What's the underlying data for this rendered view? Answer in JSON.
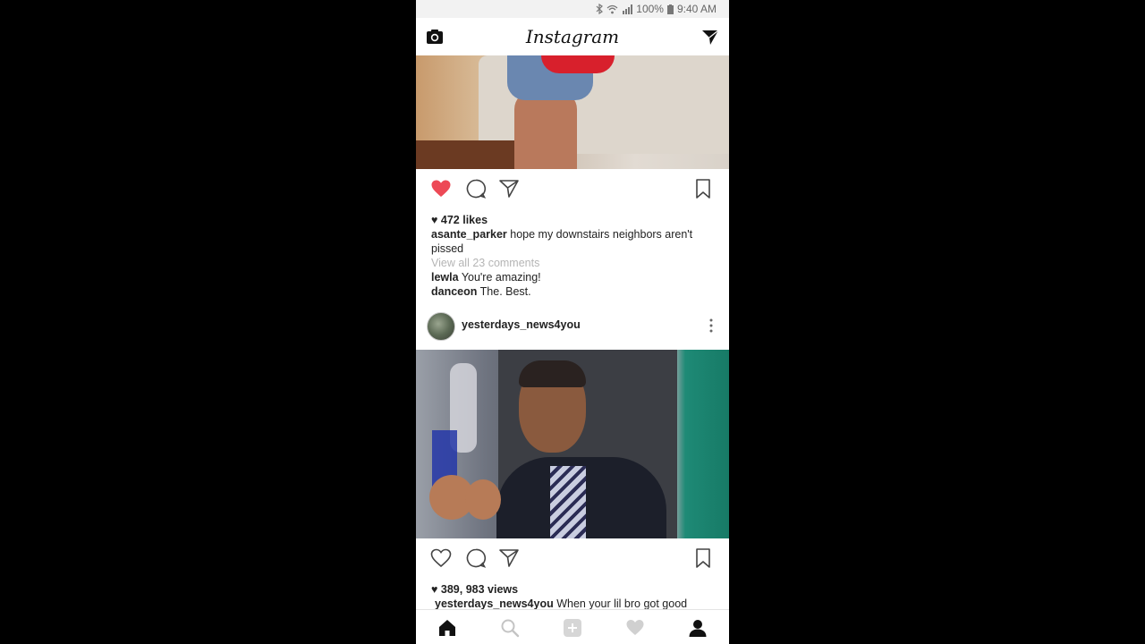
{
  "status_bar": {
    "battery": "100%",
    "time": "9:40 AM"
  },
  "header": {
    "title": "Instagram",
    "camera_icon": "camera-icon",
    "direct_icon": "direct-message-icon"
  },
  "post1": {
    "liked": true,
    "likes": "472 likes",
    "caption_user": "asante_parker",
    "caption_text": "hope my downstairs neighbors aren't pissed",
    "view_comments": "View all 23 comments",
    "comments": [
      {
        "user": "lewla",
        "text": "You're amazing!"
      },
      {
        "user": "danceon",
        "text": "The. Best."
      }
    ]
  },
  "post2": {
    "username": "yesterdays_news4you",
    "liked": false,
    "views": "389, 983 views",
    "caption_user": "yesterdays_news4you",
    "caption_text": "When your lil bro got good"
  },
  "colors": {
    "like_red": "#ed4956",
    "muted": "#b5b5b5"
  },
  "nav": [
    "home-icon",
    "search-icon",
    "add-post-icon",
    "activity-heart-icon",
    "profile-icon"
  ]
}
